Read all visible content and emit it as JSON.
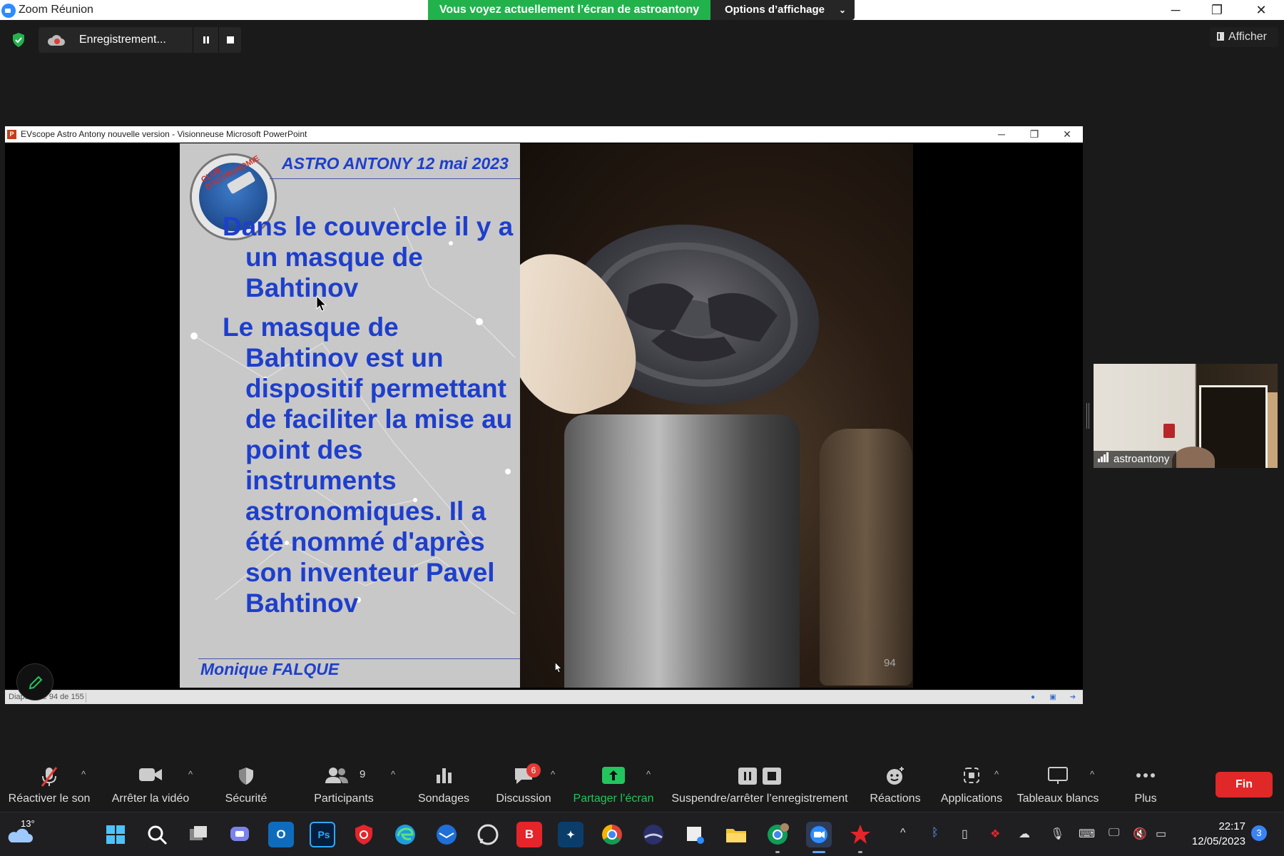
{
  "window": {
    "app_title": "Zoom Réunion",
    "share_banner": "Vous voyez actuellement l’écran de astroantony",
    "view_options": "Options d’affichage"
  },
  "recording": {
    "label": "Enregistrement...",
    "show_label": "Afficher"
  },
  "ppt": {
    "title": "EVscope Astro Antony nouvelle version - Visionneuse Microsoft PowerPoint",
    "status": "Diapositive 94 de 155",
    "slide": {
      "header": "ASTRO ANTONY 12 mai 2023",
      "logo_text": "CLUB D'ASTRONOMIE",
      "para1": "Dans le couvercle il y a un masque de Bahtinov",
      "para2": "Le masque de Bahtinov est un dispositif permettant de faciliter la mise au point des instruments astronomiques. Il a été nommé d'après son inventeur Pavel Bahtinov",
      "author": "Monique FALQUE",
      "number": "94"
    }
  },
  "participant": {
    "name": "astroantony"
  },
  "toolbar": {
    "unmute": "Réactiver le son",
    "stop_video": "Arrêter la vidéo",
    "security": "Sécurité",
    "participants": "Participants",
    "participants_count": "9",
    "polls": "Sondages",
    "chat": "Discussion",
    "chat_badge": "6",
    "share": "Partager l’écran",
    "pause_rec": "Suspendre/arrêter l’enregistrement",
    "reactions": "Réactions",
    "apps": "Applications",
    "whiteboards": "Tableaux blancs",
    "more": "Plus",
    "end": "Fin"
  },
  "taskbar": {
    "temperature": "13°",
    "time": "22:17",
    "date": "12/05/2023",
    "notifications": "3"
  },
  "colors": {
    "accent_green": "#22b24c",
    "slide_text_blue": "#1e3fcc",
    "end_red": "#e02828"
  }
}
